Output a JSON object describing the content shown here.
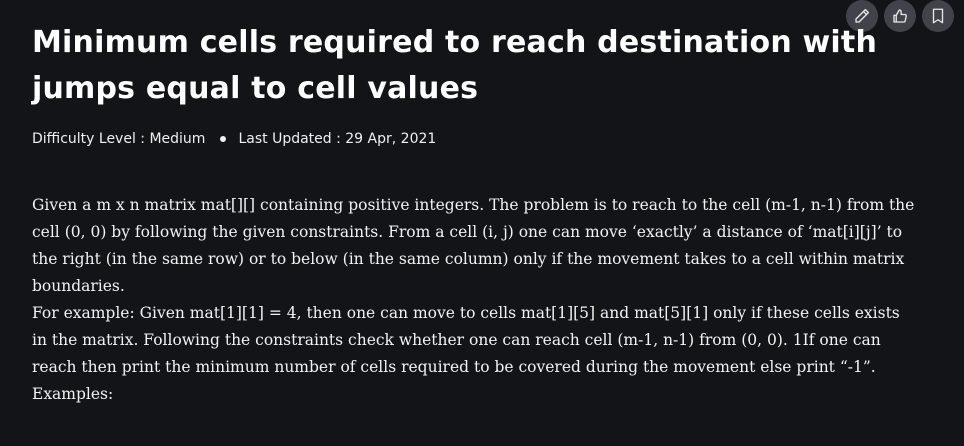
{
  "toolbar": {
    "icons": [
      "pencil-icon",
      "thumbs-up-icon",
      "bookmark-icon"
    ]
  },
  "article": {
    "title": "Minimum cells required to reach destination with jumps equal to cell values",
    "difficulty": "Difficulty Level : Medium",
    "last_updated": "Last Updated : 29 Apr, 2021",
    "paragraphs": [
      "Given a m x n matrix mat[][] containing positive integers. The problem is to reach to the cell (m-1, n-1) from the cell (0, 0) by following the given constraints. From a cell (i, j) one can move ‘exactly’ a distance of ‘mat[i][j]’ to the right (in the same row) or to below (in the same column) only if the movement takes to a cell within matrix boundaries.",
      "For example: Given mat[1][1] = 4, then one can move to cells mat[1][5] and mat[5][1] only if these cells exists in the matrix. Following the constraints check whether one can reach cell (m-1, n-1) from (0, 0). 1If one can reach then print the minimum number of cells required to be covered during the movement else print “-1”.",
      "Examples:"
    ]
  },
  "colors": {
    "background": "#131417",
    "text": "#ffffff",
    "button_bg": "#41434a"
  }
}
